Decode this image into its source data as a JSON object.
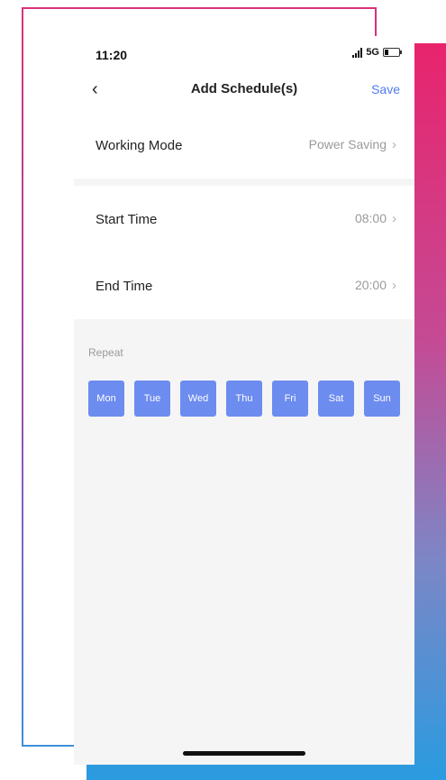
{
  "status_bar": {
    "time": "11:20",
    "network": "5G",
    "icons": [
      "signal-icon",
      "battery-icon"
    ]
  },
  "header": {
    "back_icon": "chevron-left-icon",
    "title": "Add Schedule(s)",
    "save_label": "Save",
    "accent_color": "#4f7bf0"
  },
  "settings": {
    "working_mode": {
      "label": "Working Mode",
      "value": "Power Saving"
    },
    "start_time": {
      "label": "Start Time",
      "value": "08:00"
    },
    "end_time": {
      "label": "End Time",
      "value": "20:00"
    },
    "chevron": "›"
  },
  "repeat": {
    "label": "Repeat",
    "selected_color": "#6d8cf0",
    "days": [
      "Mon",
      "Tue",
      "Wed",
      "Thu",
      "Fri",
      "Sat",
      "Sun"
    ],
    "selected": [
      true,
      true,
      true,
      true,
      true,
      true,
      true
    ]
  }
}
